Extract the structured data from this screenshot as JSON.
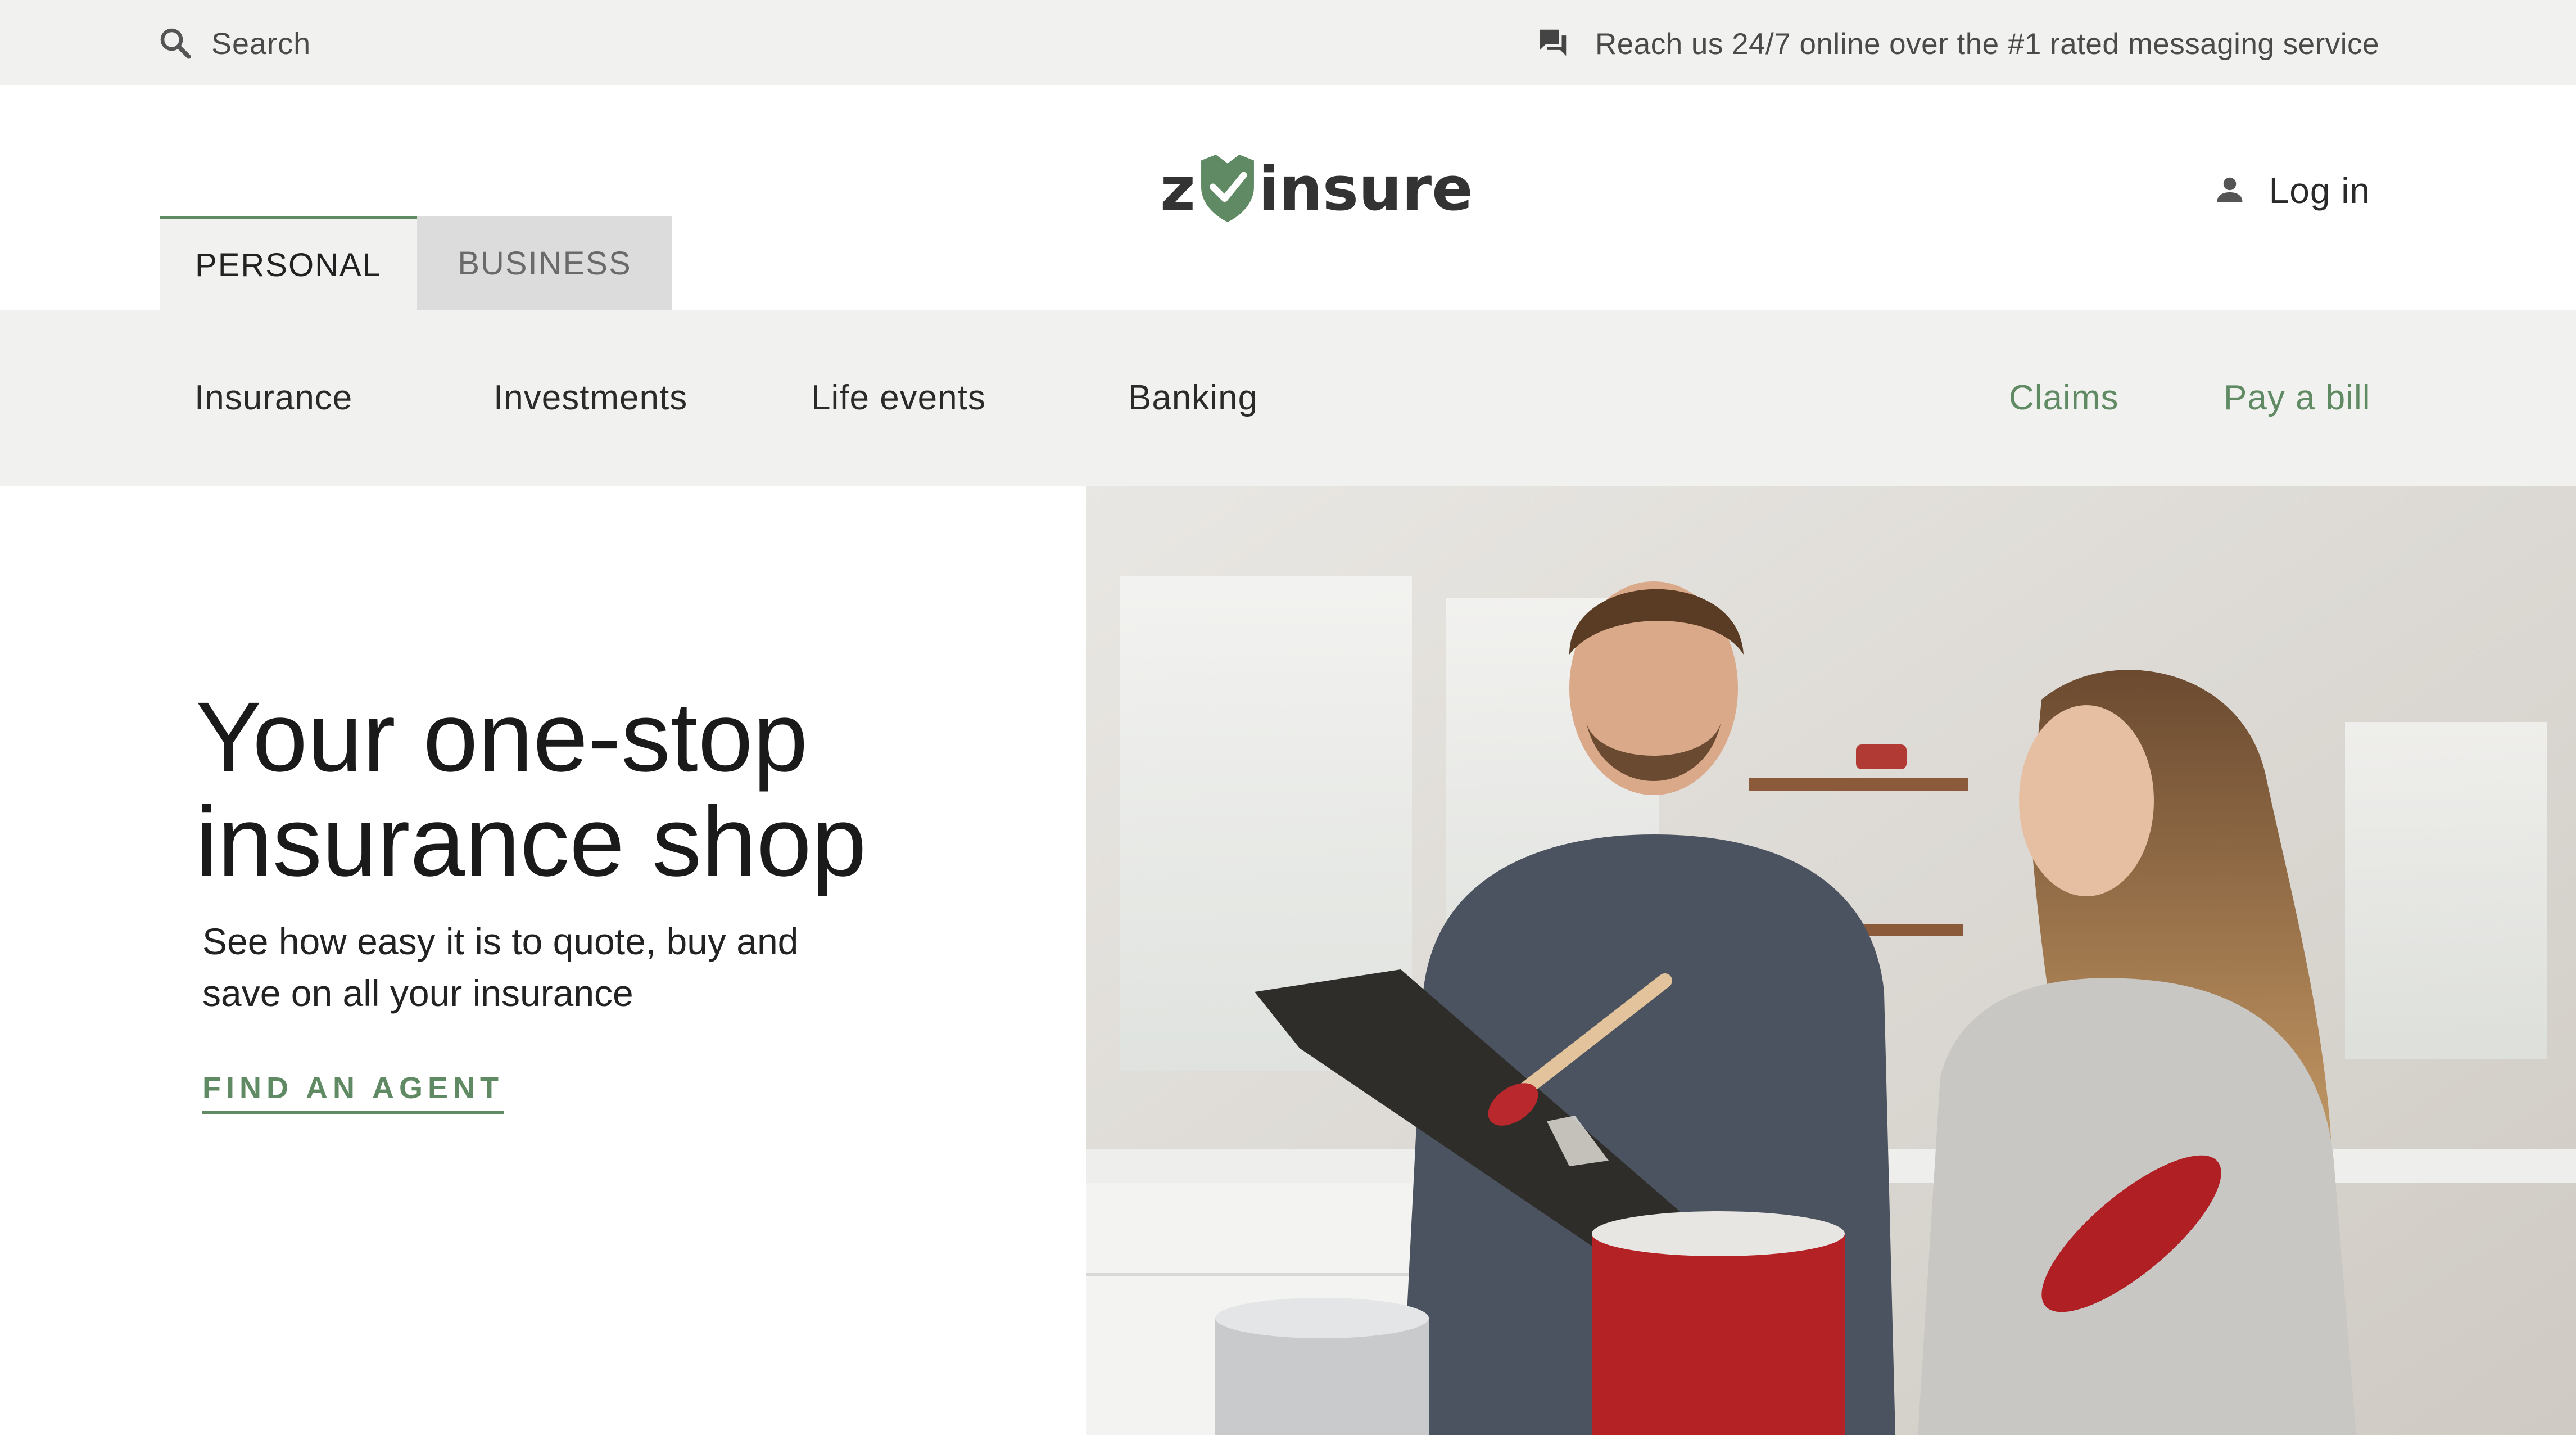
{
  "utility": {
    "search_label": "Search",
    "contact_text": "Reach us 24/7 online over the #1 rated messaging service",
    "search_icon": "search-icon",
    "chat_icon": "chat-icon"
  },
  "header": {
    "tabs": [
      {
        "label": "PERSONAL",
        "active": true
      },
      {
        "label": "BUSINESS",
        "active": false
      }
    ],
    "logo": {
      "prefix": "z",
      "word": "insure",
      "icon": "shield-check-icon"
    },
    "login_label": "Log in",
    "login_icon": "person-icon"
  },
  "nav": {
    "items": [
      "Insurance",
      "Investments",
      "Life events",
      "Banking"
    ],
    "actions": [
      "Claims",
      "Pay a bill"
    ]
  },
  "hero": {
    "headline_line1": "Your one-stop",
    "headline_line2": "insurance shop",
    "subtext_line1": "See how easy it is to quote, buy and",
    "subtext_line2": "save on all your insurance",
    "cta_label": "FIND AN AGENT"
  },
  "colors": {
    "accent_green": "#5f8a63",
    "bar_gray": "#f1f1ef",
    "tab_inactive": "#dcdcdc",
    "text_dark": "#1f1f1f"
  }
}
